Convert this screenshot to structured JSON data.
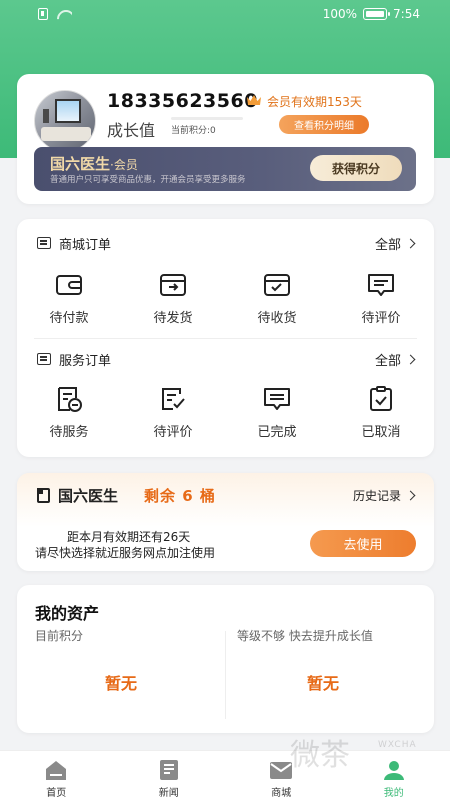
{
  "status_bar": {
    "battery": "100%",
    "time": "7:54"
  },
  "profile": {
    "phone": "18335623560",
    "vip_expire": "会员有效期153天",
    "growth_label": "成长值",
    "points_text": "当前积分:0",
    "growth_progress": 0,
    "points_detail_button": "查看积分明细",
    "member_banner": {
      "title": "国六医生",
      "subtitle": "·会员",
      "desc": "普通用户只可享受商品优惠，开通会员享受更多服务",
      "button": "获得积分"
    }
  },
  "shop_orders": {
    "title": "商城订单",
    "all": "全部",
    "items": [
      {
        "label": "待付款",
        "icon": "wallet-icon"
      },
      {
        "label": "待发货",
        "icon": "ship-box-icon"
      },
      {
        "label": "待收货",
        "icon": "receive-box-icon"
      },
      {
        "label": "待评价",
        "icon": "comment-icon"
      }
    ]
  },
  "service_orders": {
    "title": "服务订单",
    "all": "全部",
    "items": [
      {
        "label": "待服务",
        "icon": "service-doc-icon"
      },
      {
        "label": "待评价",
        "icon": "edit-check-icon"
      },
      {
        "label": "已完成",
        "icon": "message-done-icon"
      },
      {
        "label": "已取消",
        "icon": "clipboard-check-icon"
      }
    ]
  },
  "doctor": {
    "title": "国六医生",
    "remain": "剩余 6 桶",
    "history": "历史记录",
    "line1": "距本月有效期还有26天",
    "line2": "请尽快选择就近服务网点加注使用",
    "use_button": "去使用"
  },
  "assets": {
    "title": "我的资产",
    "left_label": "目前积分",
    "left_value": "暂无",
    "right_label": "等级不够 快去提升成长值",
    "right_value": "暂无"
  },
  "tabs": [
    {
      "label": "首页",
      "icon": "home-icon",
      "active": false
    },
    {
      "label": "新闻",
      "icon": "news-icon",
      "active": false
    },
    {
      "label": "商城",
      "icon": "mail-icon",
      "active": false
    },
    {
      "label": "我的",
      "icon": "profile-icon",
      "active": true
    }
  ],
  "watermark": {
    "main": "微茶",
    "small": "WXCHA"
  },
  "colors": {
    "brand_green": "#3dba78",
    "accent_orange": "#e76a17"
  }
}
